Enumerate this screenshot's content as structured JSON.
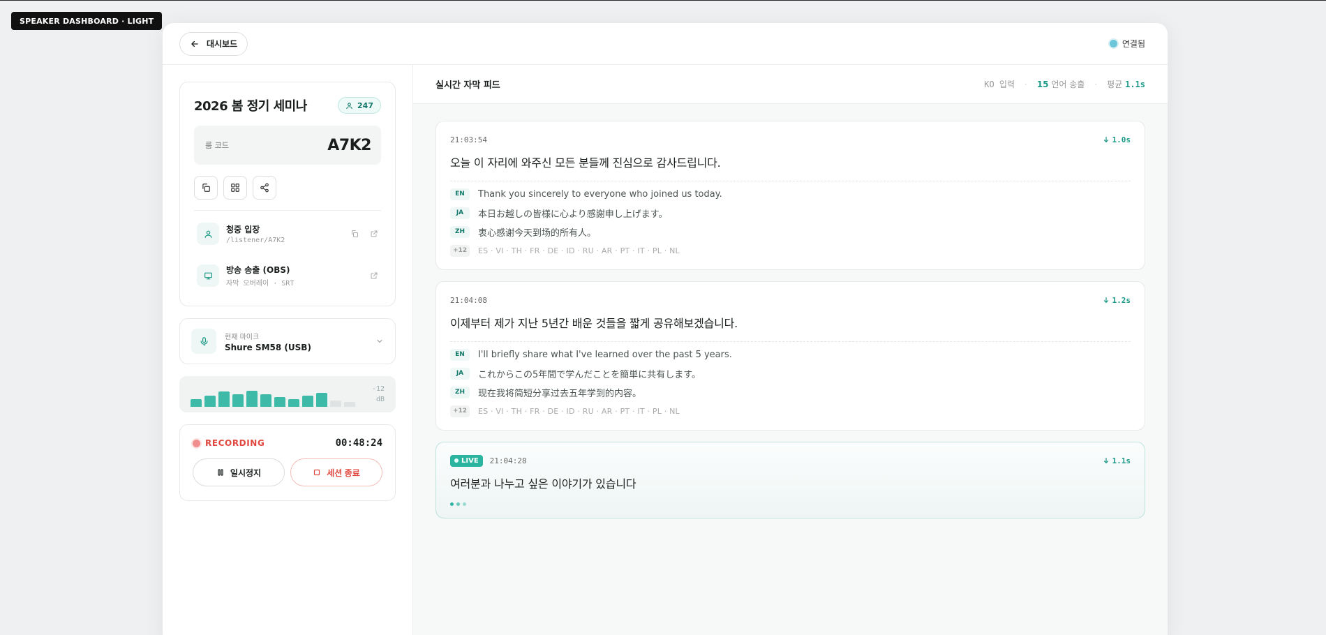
{
  "tag": "SPEAKER DASHBOARD · LIGHT",
  "topbar": {
    "back_label": "대시보드",
    "connection_status": "연결됨"
  },
  "event": {
    "title": "2026 봄 정기 세미나",
    "audience_count": "247",
    "room_label": "룸 코드",
    "room_code": "A7K2"
  },
  "links": [
    {
      "title": "청중 입장",
      "sub": "/listener/A7K2"
    },
    {
      "title": "방송 송출 (OBS)",
      "sub": "자막 오버레이 · SRT"
    }
  ],
  "mic": {
    "label": "현재 마이크",
    "name": "Shure SM58 (USB)"
  },
  "meter": {
    "db_value": "-12",
    "db_unit": "dB",
    "levels": [
      0.3,
      0.45,
      0.6,
      0.5,
      0.65,
      0.5,
      0.4,
      0.3,
      0.45,
      0.55,
      0.25,
      0.2
    ],
    "active_count": 10,
    "active_color": "#3dbba8",
    "idle_color": "#dfe3e3"
  },
  "recording": {
    "label": "RECORDING",
    "elapsed": "00:48:24",
    "pause_label": "일시정지",
    "end_label": "세션 종료"
  },
  "feed": {
    "title": "실시간 자막 피드",
    "input_lang": "KO 입력",
    "lang_count": "15",
    "lang_text": "언어 송출",
    "avg_label": "평균",
    "avg_value": "1.1s"
  },
  "messages": [
    {
      "time": "21:03:54",
      "latency": "1.0s",
      "source": "오늘 이 자리에 와주신 모든 분들께 진심으로 감사드립니다.",
      "translations": [
        {
          "lang": "EN",
          "text": "Thank you sincerely to everyone who joined us today."
        },
        {
          "lang": "JA",
          "text": "本日お越しの皆様に心より感謝申し上げます。"
        },
        {
          "lang": "ZH",
          "text": "衷心感谢今天到场的所有人。"
        }
      ],
      "more_count": "+12",
      "more_langs": "ES · VI · TH · FR · DE · ID · RU · AR · PT · IT · PL · NL"
    },
    {
      "time": "21:04:08",
      "latency": "1.2s",
      "source": "이제부터 제가 지난 5년간 배운 것들을 짧게 공유해보겠습니다.",
      "translations": [
        {
          "lang": "EN",
          "text": "I'll briefly share what I've learned over the past 5 years."
        },
        {
          "lang": "JA",
          "text": "これからこの5年間で学んだことを簡単に共有します。"
        },
        {
          "lang": "ZH",
          "text": "现在我将简短分享过去五年学到的内容。"
        }
      ],
      "more_count": "+12",
      "more_langs": "ES · VI · TH · FR · DE · ID · RU · AR · PT · IT · PL · NL"
    }
  ],
  "live": {
    "badge": "LIVE",
    "time": "21:04:28",
    "latency": "1.1s",
    "source": "여러분과 나누고 싶은 이야기가 있습니다"
  }
}
